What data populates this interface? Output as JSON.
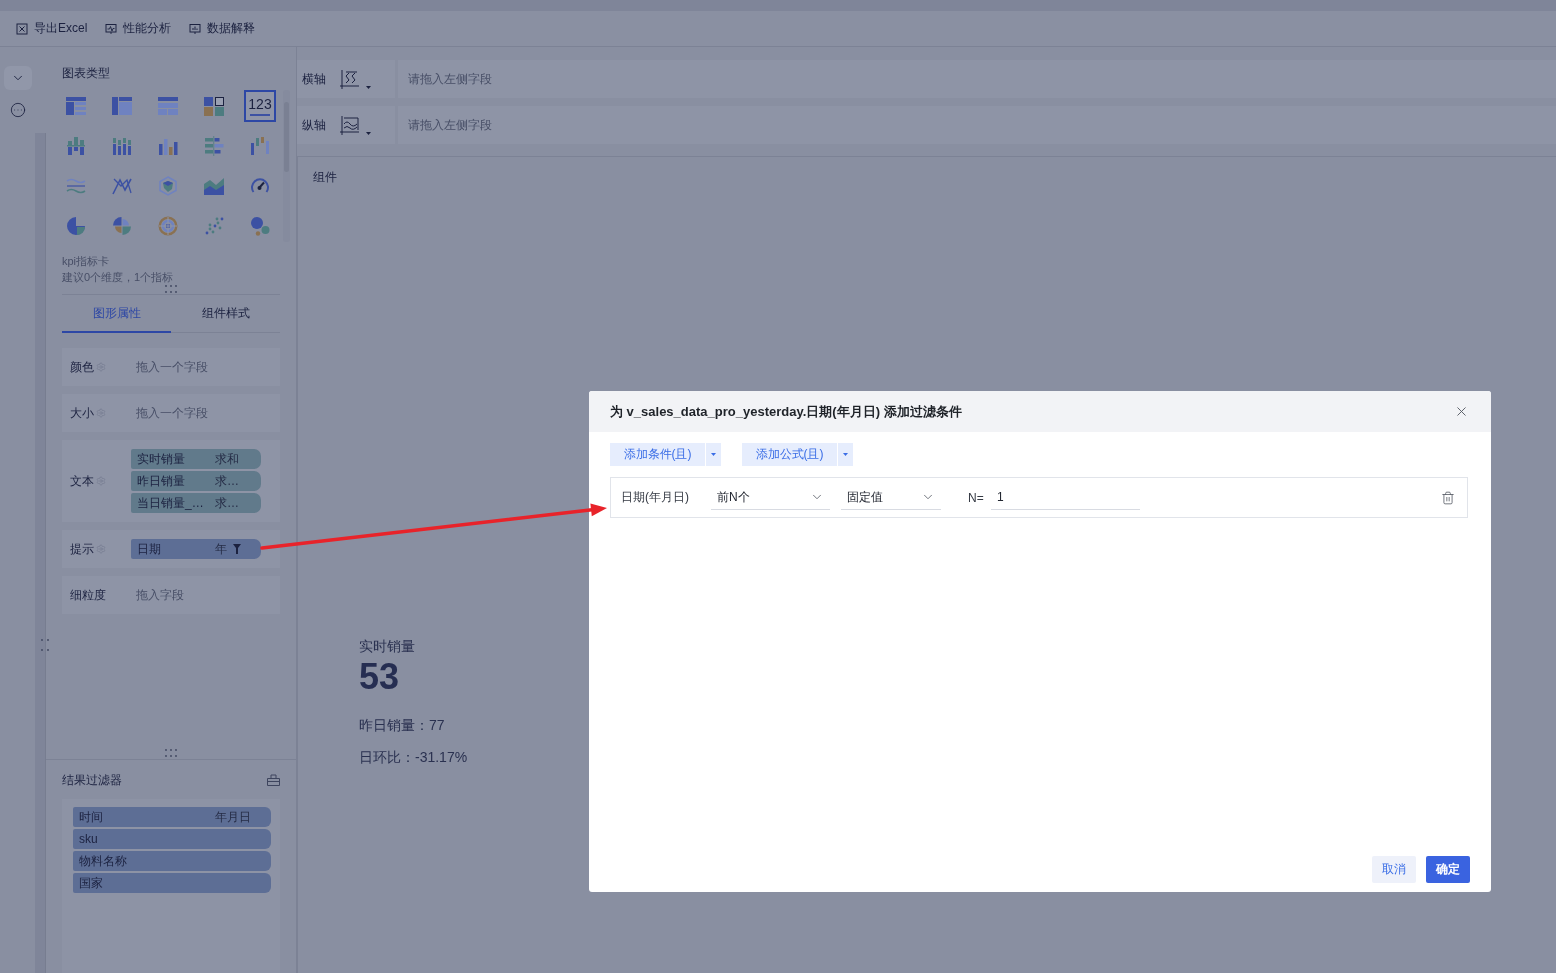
{
  "toolbar": {
    "items": [
      {
        "kind": "excel",
        "label": "导出Excel"
      },
      {
        "kind": "performance",
        "label": "性能分析"
      },
      {
        "kind": "explain",
        "label": "数据解释"
      }
    ]
  },
  "chart_panel": {
    "title": "图表类型",
    "types": [
      {
        "kind": "table",
        "selected": false
      },
      {
        "kind": "pivot-table",
        "selected": false
      },
      {
        "kind": "detail-table",
        "selected": false
      },
      {
        "kind": "tiles",
        "selected": false
      },
      {
        "kind": "kpi",
        "text": "123",
        "selected": true
      },
      {
        "kind": "stacked-bar",
        "selected": false
      },
      {
        "kind": "striped-column",
        "selected": false
      },
      {
        "kind": "column",
        "selected": false
      },
      {
        "kind": "horizontal-bar",
        "selected": false
      },
      {
        "kind": "waterfall",
        "selected": false
      },
      {
        "kind": "wave",
        "selected": false
      },
      {
        "kind": "crossing-lines",
        "selected": false
      },
      {
        "kind": "radar",
        "selected": false
      },
      {
        "kind": "area",
        "selected": false
      },
      {
        "kind": "gauge",
        "selected": false
      },
      {
        "kind": "pie",
        "selected": false
      },
      {
        "kind": "rose",
        "selected": false
      },
      {
        "kind": "sunburst",
        "selected": false
      },
      {
        "kind": "scatter",
        "selected": false
      },
      {
        "kind": "bubble",
        "selected": false
      }
    ],
    "description": {
      "name": "kpi指标卡",
      "hint": "建议0个维度，1个指标"
    }
  },
  "property_tabs": [
    {
      "label": "图形属性",
      "selected": true
    },
    {
      "label": "组件样式",
      "selected": false
    }
  ],
  "properties": [
    {
      "label": "颜色",
      "settings": true,
      "drop_hint": "拖入一个字段"
    },
    {
      "label": "大小",
      "settings": true,
      "drop_hint": "拖入一个字段"
    },
    {
      "label": "文本",
      "settings": true,
      "fields": [
        {
          "kind": "measure",
          "name": "实时销量",
          "aggregate": "求和",
          "filtered": false
        },
        {
          "kind": "measure",
          "name": "昨日销量",
          "aggregate": "求…",
          "filtered": false
        },
        {
          "kind": "measure",
          "name": "当日销量_…",
          "aggregate": "求…",
          "filtered": false
        }
      ]
    },
    {
      "label": "提示",
      "settings": true,
      "fields": [
        {
          "kind": "dimension",
          "name": "日期",
          "aggregate": "年",
          "filtered": true
        }
      ]
    },
    {
      "label": "细粒度",
      "settings": false,
      "drop_hint": "拖入字段"
    }
  ],
  "result_filter": {
    "title": "结果过滤器",
    "fields": [
      {
        "name": "时间",
        "detail": "年月日"
      },
      {
        "name": "sku"
      },
      {
        "name": "物料名称"
      },
      {
        "name": "国家"
      }
    ]
  },
  "axes": [
    {
      "kind": "x",
      "label": "横轴",
      "drop_hint": "请拖入左侧字段"
    },
    {
      "kind": "y",
      "label": "纵轴",
      "drop_hint": "请拖入左侧字段"
    }
  ],
  "component": {
    "title": "组件",
    "kpi": {
      "label": "实时销量",
      "value": "53",
      "lines": [
        "昨日销量：77",
        "日环比：-31.17%"
      ]
    }
  },
  "dialog": {
    "title": "为 v_sales_data_pro_yesterday.日期(年月日) 添加过滤条件",
    "actions": [
      "添加条件(且)",
      "添加公式(且)"
    ],
    "conditions": [
      {
        "field": "日期(年月日)",
        "operator": "前N个",
        "value_type": "固定值",
        "n_label": "N=",
        "n_value": "1"
      }
    ],
    "buttons": [
      {
        "kind": "secondary",
        "label": "取消"
      },
      {
        "kind": "primary",
        "label": "确定"
      }
    ]
  }
}
